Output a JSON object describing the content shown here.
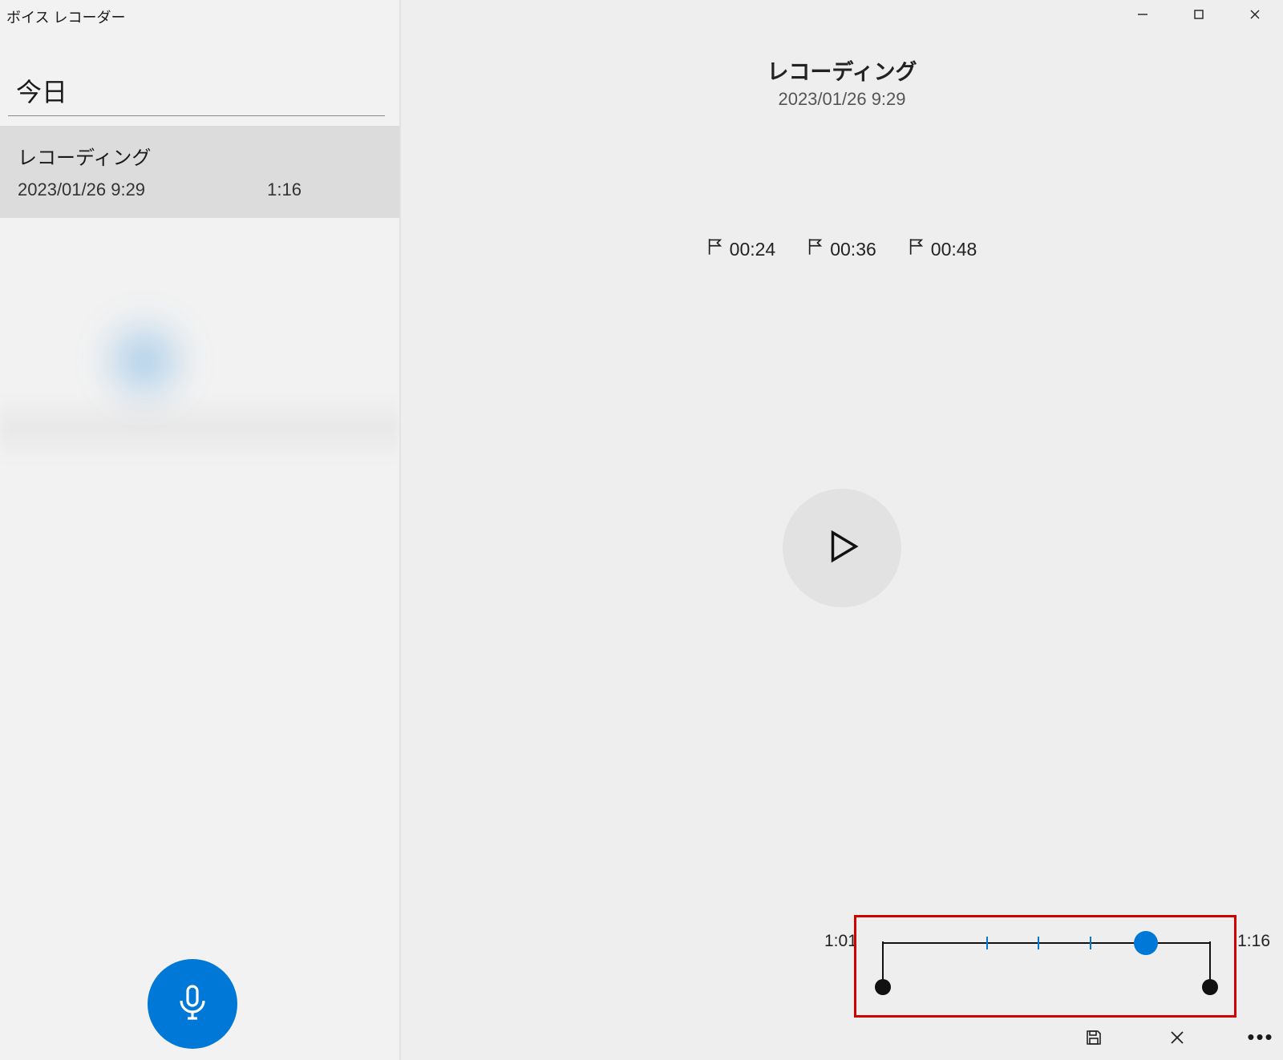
{
  "app": {
    "title": "ボイス レコーダー"
  },
  "sidebar": {
    "section_header": "今日",
    "items": [
      {
        "title": "レコーディング",
        "datetime": "2023/01/26 9:29",
        "duration": "1:16"
      }
    ]
  },
  "detail": {
    "title": "レコーディング",
    "datetime": "2023/01/26 9:29",
    "markers": [
      {
        "time": "00:24",
        "pct": 31.6
      },
      {
        "time": "00:36",
        "pct": 47.4
      },
      {
        "time": "00:48",
        "pct": 63.2
      }
    ]
  },
  "trim": {
    "start_label": "1:01",
    "end_label": "1:16",
    "playhead_pct": 80.3
  }
}
